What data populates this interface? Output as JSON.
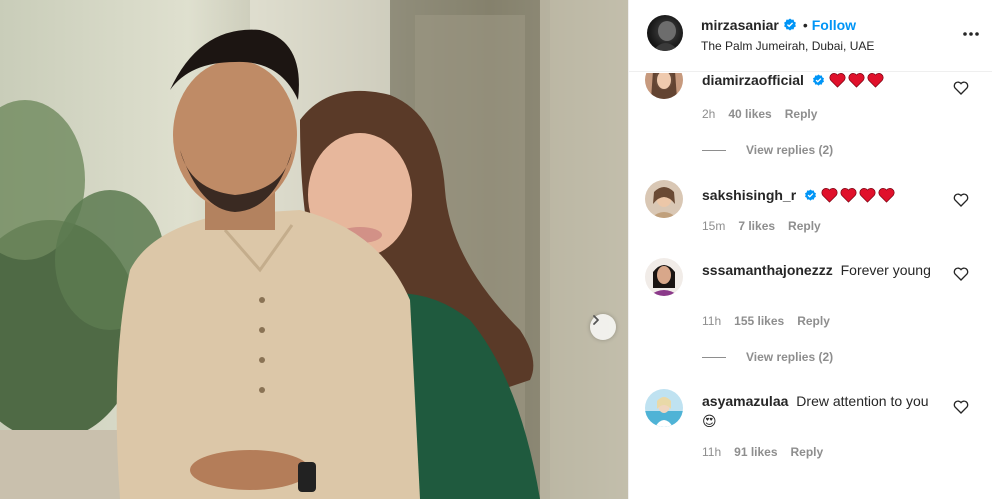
{
  "post": {
    "owner": "mirzasaniar",
    "separator": "•",
    "follow_label": "Follow",
    "location": "The Palm Jumeirah, Dubai, UAE"
  },
  "comments": [
    {
      "user": "diamirzaofficial",
      "verified": true,
      "text": "",
      "hearts": 3,
      "time": "2h",
      "likes": "40 likes",
      "reply": "Reply",
      "view_replies": "View replies (2)"
    },
    {
      "user": "sakshisingh_r",
      "verified": true,
      "text": "",
      "hearts": 4,
      "time": "15m",
      "likes": "7 likes",
      "reply": "Reply",
      "view_replies": ""
    },
    {
      "user": "sssamanthajonezzz",
      "verified": false,
      "text": "Forever young",
      "time": "11h",
      "likes": "155 likes",
      "reply": "Reply",
      "view_replies": "View replies (2)"
    },
    {
      "user": "asyamazulaa",
      "verified": false,
      "text": "Drew attention to you 😍",
      "time": "11h",
      "likes": "91 likes",
      "reply": "Reply",
      "view_replies": ""
    }
  ],
  "colors": {
    "accent": "#0095f6",
    "heart": "#ed4956",
    "muted": "#8e8e8e"
  },
  "icons": {
    "verified": "verified-badge-icon",
    "more": "more-options-icon",
    "like": "heart-outline-icon",
    "next": "chevron-right-icon"
  }
}
